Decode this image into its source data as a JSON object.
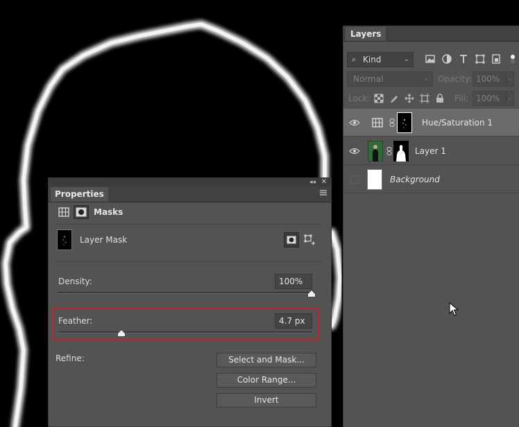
{
  "layers_panel": {
    "tab_label": "Layers",
    "filter": {
      "kind_label": "Kind"
    },
    "blend_mode": "Normal",
    "opacity_label": "Opacity:",
    "opacity_value": "100%",
    "lock_label": "Lock:",
    "fill_label": "Fill:",
    "fill_value": "100%",
    "layers": [
      {
        "name": "Hue/Saturation 1",
        "selected": true,
        "visible": true
      },
      {
        "name": "Layer 1",
        "selected": false,
        "visible": true
      },
      {
        "name": "Background",
        "selected": false,
        "visible": false
      }
    ]
  },
  "properties_panel": {
    "tab_label": "Properties",
    "section_title": "Masks",
    "mask_type_label": "Layer Mask",
    "density_label": "Density:",
    "density_value": "100%",
    "density_level": 1.0,
    "feather_label": "Feather:",
    "feather_value": "4.7 px",
    "feather_level": 0.25,
    "refine_label": "Refine:",
    "buttons": {
      "select_and_mask": "Select and Mask...",
      "color_range": "Color Range...",
      "invert": "Invert"
    }
  },
  "colors": {
    "panel_bg": "#535353",
    "selected_row": "#6b6b6b",
    "highlight_border": "#c1272d",
    "canvas_bg": "#000000"
  }
}
